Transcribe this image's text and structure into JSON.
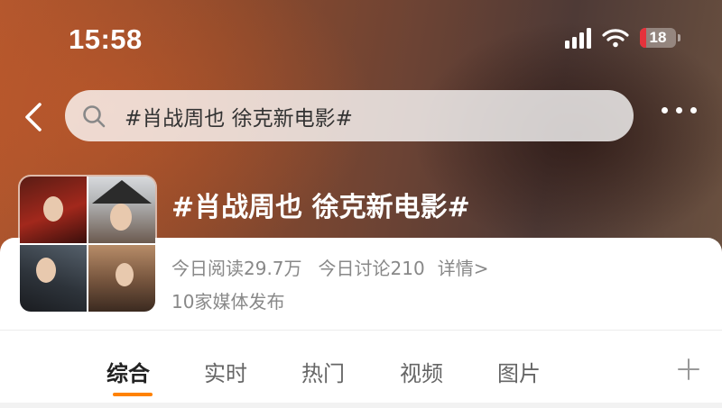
{
  "status_bar": {
    "time": "15:58",
    "battery": "18",
    "battery_level": 0.18
  },
  "search": {
    "value": "#肖战周也 徐克新电影#"
  },
  "topic": {
    "title": "#肖战周也 徐克新电影#",
    "read_today": "今日阅读29.7万",
    "discuss_today": "今日讨论210",
    "details_link": "详情>",
    "media": "10家媒体发布"
  },
  "tabs": [
    {
      "label": "综合",
      "active": true
    },
    {
      "label": "实时"
    },
    {
      "label": "热门"
    },
    {
      "label": "视频"
    },
    {
      "label": "图片"
    }
  ],
  "colors": {
    "accent": "#ff8200",
    "battery_red": "#e5323b"
  },
  "icons": [
    "signal-icon",
    "wifi-icon",
    "battery-icon",
    "back-icon",
    "search-icon",
    "more-icon",
    "add-tab-icon"
  ]
}
